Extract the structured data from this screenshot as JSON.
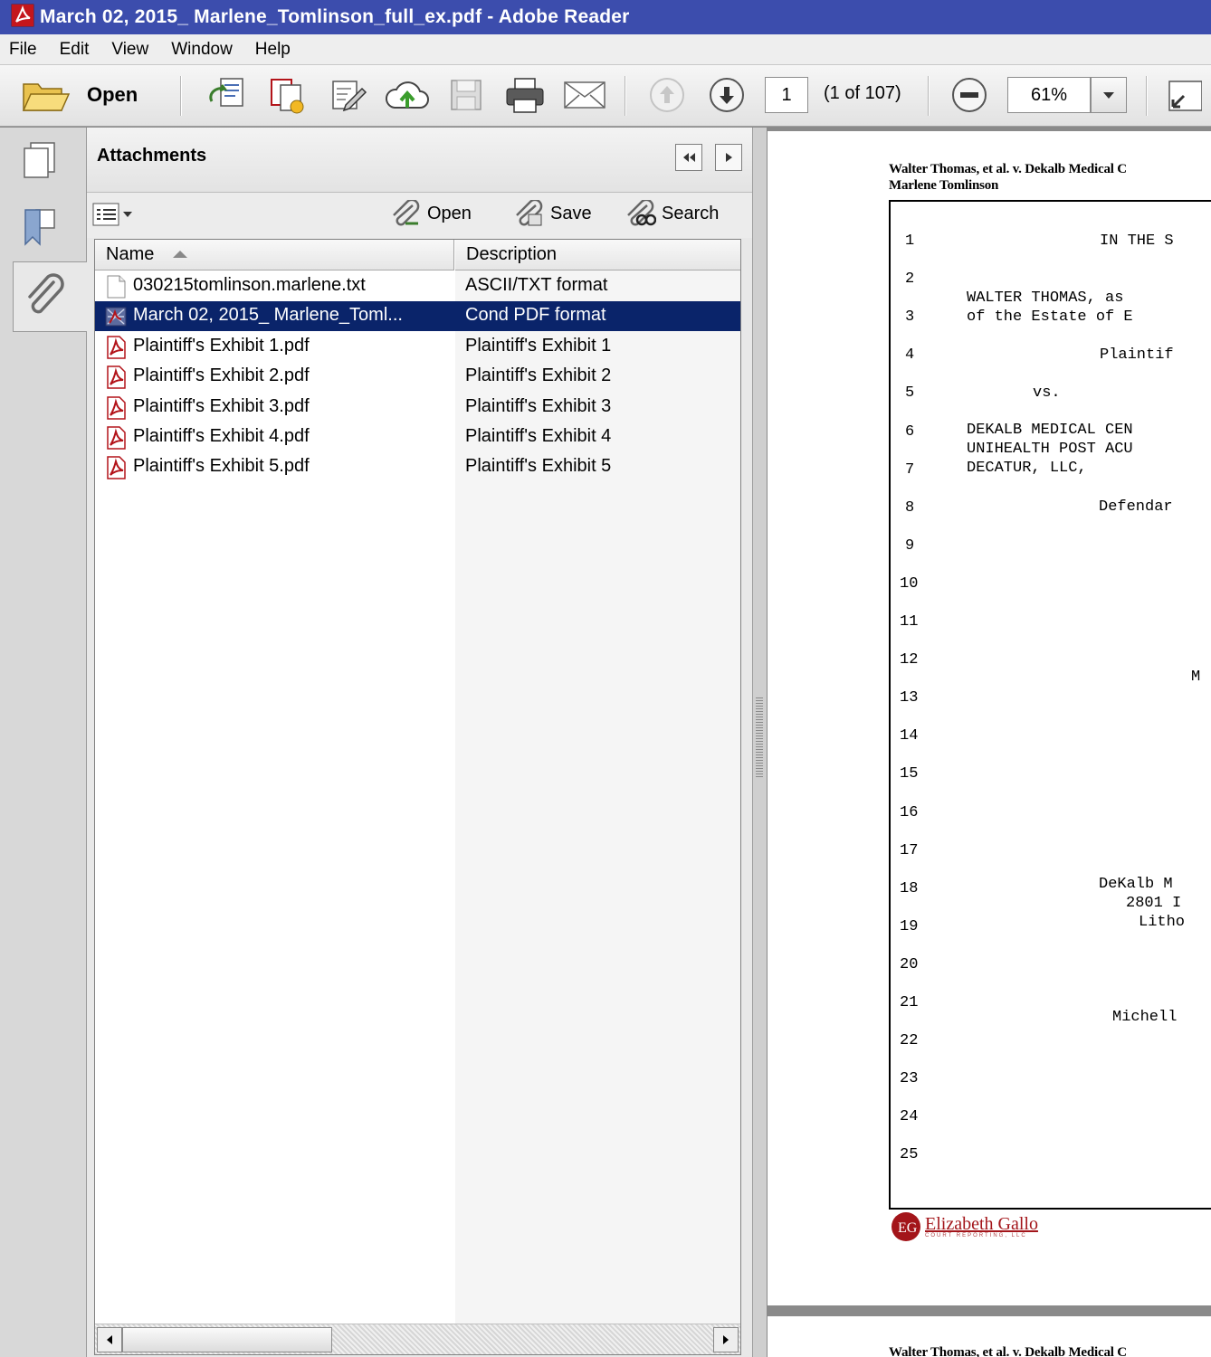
{
  "window": {
    "title": "March 02, 2015_ Marlene_Tomlinson_full_ex.pdf - Adobe Reader"
  },
  "menu": [
    "File",
    "Edit",
    "View",
    "Window",
    "Help"
  ],
  "toolbar": {
    "open_label": "Open",
    "page_number": "1",
    "page_count": "(1 of 107)",
    "zoom": "61%"
  },
  "panel": {
    "title": "Attachments",
    "actions": {
      "open": "Open",
      "save": "Save",
      "search": "Search"
    },
    "columns": {
      "name": "Name",
      "description": "Description"
    },
    "attachments": [
      {
        "name": "030215tomlinson.marlene.txt",
        "description": "ASCII/TXT format",
        "icon": "text-file-icon",
        "selected": false
      },
      {
        "name": "March 02, 2015_ Marlene_Toml...",
        "description": "Cond PDF format",
        "icon": "pdf-portfolio-icon",
        "selected": true
      },
      {
        "name": "Plaintiff's Exhibit 1.pdf",
        "description": "Plaintiff's Exhibit 1",
        "icon": "pdf-file-icon",
        "selected": false
      },
      {
        "name": "Plaintiff's Exhibit 2.pdf",
        "description": "Plaintiff's Exhibit 2",
        "icon": "pdf-file-icon",
        "selected": false
      },
      {
        "name": "Plaintiff's Exhibit 3.pdf",
        "description": "Plaintiff's Exhibit 3",
        "icon": "pdf-file-icon",
        "selected": false
      },
      {
        "name": "Plaintiff's Exhibit 4.pdf",
        "description": "Plaintiff's Exhibit 4",
        "icon": "pdf-file-icon",
        "selected": false
      },
      {
        "name": "Plaintiff's Exhibit 5.pdf",
        "description": "Plaintiff's Exhibit 5",
        "icon": "pdf-file-icon",
        "selected": false
      }
    ]
  },
  "document": {
    "header_line1": "Walter Thomas, et al. v. Dekalb Medical C",
    "header_line2": "Marlene Tomlinson",
    "line_numbers": [
      "1",
      "2",
      "3",
      "4",
      "5",
      "6",
      "7",
      "8",
      "9",
      "10",
      "11",
      "12",
      "13",
      "14",
      "15",
      "16",
      "17",
      "18",
      "19",
      "20",
      "21",
      "22",
      "23",
      "24",
      "25"
    ],
    "text_lines": [
      {
        "text": "IN THE S"
      },
      {
        "text": "WALTER THOMAS, as"
      },
      {
        "text": "of the Estate of E"
      },
      {
        "text": "Plaintif"
      },
      {
        "text": "vs."
      },
      {
        "text": "DEKALB MEDICAL CEN"
      },
      {
        "text": "UNIHEALTH POST ACU"
      },
      {
        "text": "DECATUR, LLC,"
      },
      {
        "text": "Defendar"
      },
      {
        "text": "M"
      },
      {
        "text": "DeKalb M"
      },
      {
        "text": "2801 I"
      },
      {
        "text": "Litho"
      },
      {
        "text": "Michell"
      }
    ],
    "logo_text": "Elizabeth Gallo",
    "logo_subtext": "COURT REPORTING, LLC",
    "page2_header": "Walter Thomas, et al. v. Dekalb Medical C"
  },
  "colors": {
    "titlebar": "#3c4dad",
    "selection": "#0a246a",
    "pdf_red": "#b3141a"
  }
}
